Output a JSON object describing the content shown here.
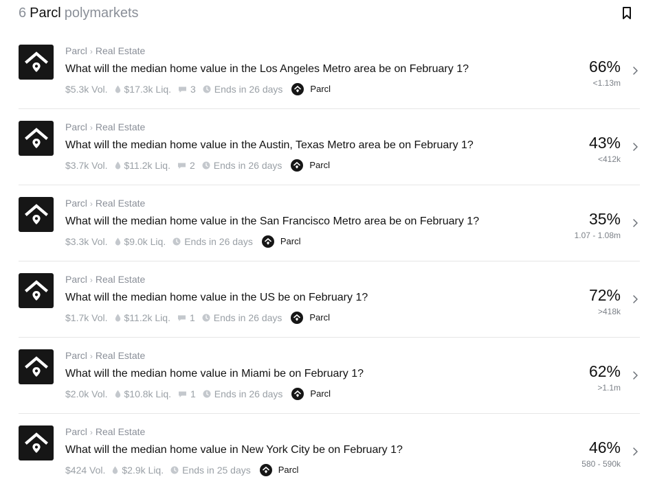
{
  "header": {
    "count": "6",
    "brand": "Parcl",
    "suffix": "polymarkets"
  },
  "icons": {
    "bookmark": "bookmark-icon",
    "logo": "parcl-house-logo",
    "liquidity": "droplet-icon",
    "comments": "comment-bubble-icon",
    "ends": "clock-icon",
    "chevron": "chevron-right-icon"
  },
  "colors": {
    "logo_bg": "#161616",
    "muted_text": "#8a8f98",
    "divider": "#e6e6e6"
  },
  "markets": [
    {
      "breadcrumb": [
        "Parcl",
        "Real Estate"
      ],
      "question": "What will the median home value in the Los Angeles Metro area be on February 1?",
      "volume": "$5.3k Vol.",
      "liquidity": "$17.3k Liq.",
      "comments": "3",
      "ends": "Ends in 26 days",
      "creator": "Parcl",
      "percent": "66%",
      "outcome": "<1.13m"
    },
    {
      "breadcrumb": [
        "Parcl",
        "Real Estate"
      ],
      "question": "What will the median home value in the Austin, Texas Metro area be on February 1?",
      "volume": "$3.7k Vol.",
      "liquidity": "$11.2k Liq.",
      "comments": "2",
      "ends": "Ends in 26 days",
      "creator": "Parcl",
      "percent": "43%",
      "outcome": "<412k"
    },
    {
      "breadcrumb": [
        "Parcl",
        "Real Estate"
      ],
      "question": "What will the median home value in the San Francisco Metro area be on February 1?",
      "volume": "$3.3k Vol.",
      "liquidity": "$9.0k Liq.",
      "comments": null,
      "ends": "Ends in 26 days",
      "creator": "Parcl",
      "percent": "35%",
      "outcome": "1.07 - 1.08m"
    },
    {
      "breadcrumb": [
        "Parcl",
        "Real Estate"
      ],
      "question": "What will the median home value in the US be on February 1?",
      "volume": "$1.7k Vol.",
      "liquidity": "$11.2k Liq.",
      "comments": "1",
      "ends": "Ends in 26 days",
      "creator": "Parcl",
      "percent": "72%",
      "outcome": ">418k"
    },
    {
      "breadcrumb": [
        "Parcl",
        "Real Estate"
      ],
      "question": "What will the median home value in Miami be on February 1?",
      "volume": "$2.0k Vol.",
      "liquidity": "$10.8k Liq.",
      "comments": "1",
      "ends": "Ends in 26 days",
      "creator": "Parcl",
      "percent": "62%",
      "outcome": ">1.1m"
    },
    {
      "breadcrumb": [
        "Parcl",
        "Real Estate"
      ],
      "question": "What will the median home value in New York City be on February 1?",
      "volume": "$424 Vol.",
      "liquidity": "$2.9k Liq.",
      "comments": null,
      "ends": "Ends in 25 days",
      "creator": "Parcl",
      "percent": "46%",
      "outcome": "580 - 590k"
    }
  ]
}
